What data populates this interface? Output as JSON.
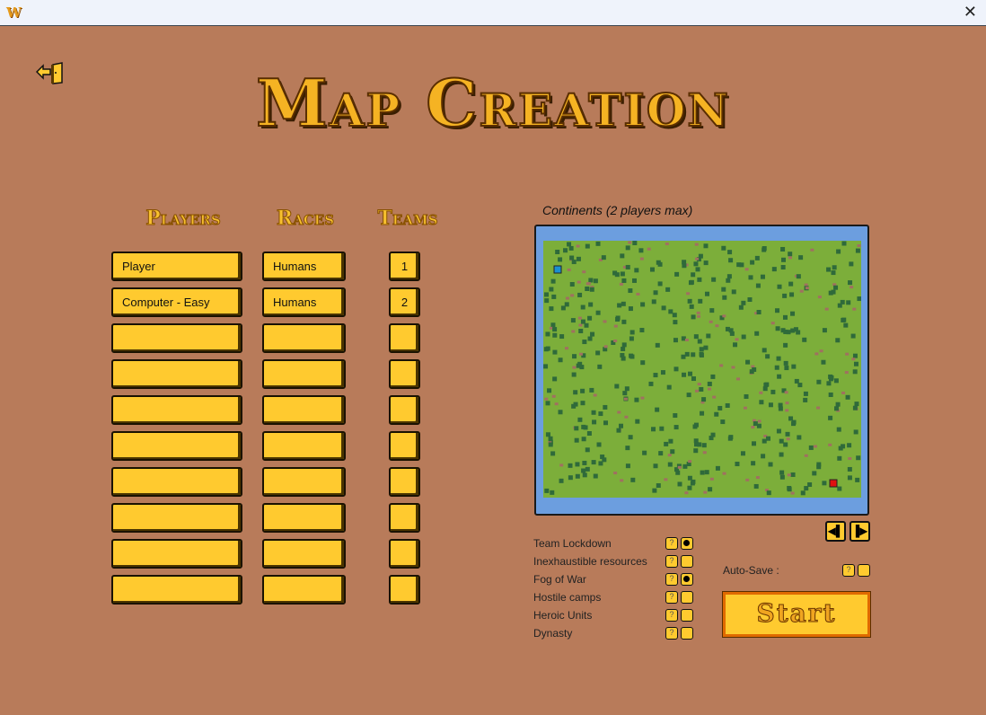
{
  "window": {
    "app_icon": "W",
    "close": "✕"
  },
  "title": "Map Creation",
  "headers": {
    "players": "Players",
    "races": "Races",
    "teams": "Teams"
  },
  "rows": [
    {
      "player": "Player",
      "race": "Humans",
      "team": "1"
    },
    {
      "player": "Computer - Easy",
      "race": "Humans",
      "team": "2"
    },
    {
      "player": "",
      "race": "",
      "team": ""
    },
    {
      "player": "",
      "race": "",
      "team": ""
    },
    {
      "player": "",
      "race": "",
      "team": ""
    },
    {
      "player": "",
      "race": "",
      "team": ""
    },
    {
      "player": "",
      "race": "",
      "team": ""
    },
    {
      "player": "",
      "race": "",
      "team": ""
    },
    {
      "player": "",
      "race": "",
      "team": ""
    },
    {
      "player": "",
      "race": "",
      "team": ""
    }
  ],
  "map": {
    "name": "Continents (2 players max)",
    "player_colors": [
      "#1a8fd0",
      "#e01010"
    ]
  },
  "nav": {
    "prev": "◀▌",
    "next": "▐▶"
  },
  "options": [
    {
      "label": "Team Lockdown",
      "checked": true
    },
    {
      "label": "Inexhaustible resources",
      "checked": false
    },
    {
      "label": "Fog of War",
      "checked": true
    },
    {
      "label": "Hostile camps",
      "checked": false
    },
    {
      "label": "Heroic Units",
      "checked": false
    },
    {
      "label": "Dynasty",
      "checked": false
    }
  ],
  "help": "?",
  "autosave": {
    "label": "Auto-Save :",
    "checked": false
  },
  "start": "Start"
}
